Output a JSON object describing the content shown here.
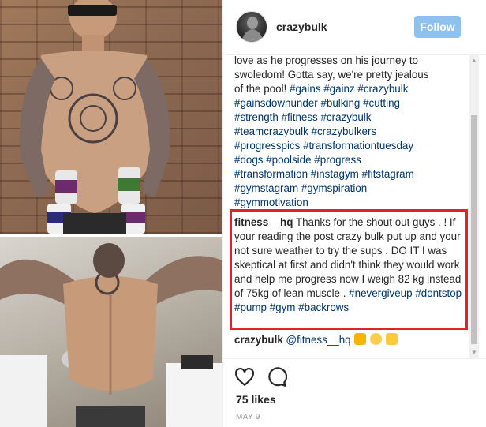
{
  "header": {
    "username": "crazybulk",
    "follow_label": "Follow"
  },
  "caption": {
    "lines": [
      "love as he progresses on his journey to",
      "swoledom! Gotta say, we're pretty jealous",
      "of the pool!"
    ],
    "hashtags": [
      "#gains",
      "#gainz",
      "#crazybulk",
      "#gainsdownunder",
      "#bulking",
      "#cutting",
      "#strength",
      "#fitness",
      "#crazybulk",
      "#teamcrazybulk",
      "#crazybulkers",
      "#progresspics",
      "#transformationtuesday",
      "#dogs",
      "#poolside",
      "#progress",
      "#transformation",
      "#instagym",
      "#fitstagram",
      "#gymstagram",
      "#gymspiration",
      "#gymmotivation"
    ]
  },
  "highlighted_comment": {
    "username": "fitness__hq",
    "text": "Thanks for the shout out guys . ! If your reading the post crazy bulk put up and your not sure weather to try the sups . DO IT I was skeptical at first and didn't think they would work and help me progress now I weigh 82 kg instead of 75kg of lean muscle .",
    "hashtags": [
      "#nevergiveup",
      "#dontstop",
      "#pump",
      "#gym",
      "#backrows"
    ]
  },
  "reply": {
    "username": "crazybulk",
    "mention": "@fitness__hq",
    "emojis": [
      "raising-hands-emoji",
      "ok-hand-emoji",
      "flexed-biceps-emoji"
    ]
  },
  "stats": {
    "likes": "75 likes",
    "date": "MAY 9"
  },
  "colors": {
    "follow_button": "#8fc1ef",
    "hashtag": "#003569",
    "highlight_border": "#e0222a"
  },
  "icons": {
    "like": "heart-icon",
    "comment": "speech-bubble-icon"
  }
}
